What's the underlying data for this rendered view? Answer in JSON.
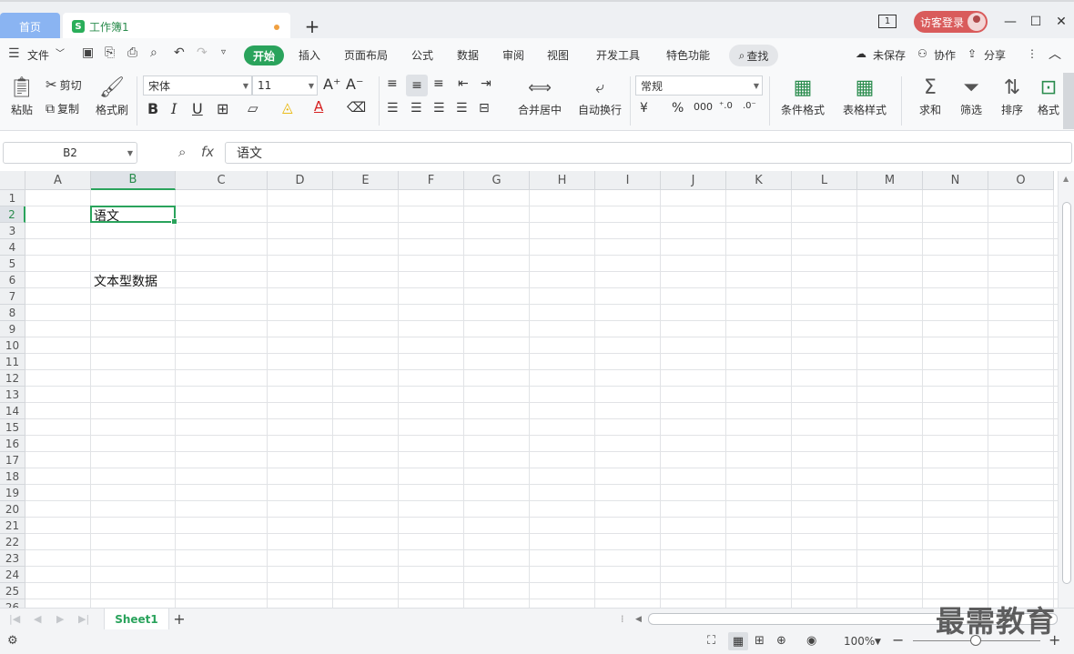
{
  "titlebar": {
    "home_tab": "首页",
    "doc_tab": "工作簿1",
    "doc_icon": "S",
    "add_tab": "+",
    "window_badge": "1",
    "login_label": "访客登录"
  },
  "menubar": {
    "file": "文件",
    "tabs": [
      "开始",
      "插入",
      "页面布局",
      "公式",
      "数据",
      "审阅",
      "视图",
      "开发工具",
      "特色功能"
    ],
    "search": "查找",
    "unsaved": "未保存",
    "collab": "协作",
    "share": "分享"
  },
  "ribbon": {
    "paste": "粘贴",
    "cut": "剪切",
    "copy": "复制",
    "format_painter": "格式刷",
    "font_name": "宋体",
    "font_size": "11",
    "merge_center": "合并居中",
    "wrap_text": "自动换行",
    "number_format": "常规",
    "conditional_format": "条件格式",
    "table_style": "表格样式",
    "sum": "求和",
    "filter": "筛选",
    "sort": "排序",
    "format": "格式"
  },
  "formula_bar": {
    "name_box": "B2",
    "fx_label": "fx",
    "content": "语文"
  },
  "grid": {
    "columns": [
      "A",
      "B",
      "C",
      "D",
      "E",
      "F",
      "G",
      "H",
      "I",
      "J",
      "K",
      "L",
      "M",
      "N",
      "O"
    ],
    "rows": [
      "1",
      "2",
      "3",
      "4",
      "5",
      "6",
      "7",
      "8",
      "9",
      "10",
      "11",
      "12",
      "13",
      "14",
      "15",
      "16",
      "17",
      "18",
      "19",
      "20",
      "21",
      "22",
      "23",
      "24",
      "25",
      "26"
    ],
    "selected_cell": "B2",
    "cells": {
      "B2": "语文",
      "B6": "文本型数据"
    }
  },
  "sheets": {
    "tabs": [
      "Sheet1"
    ],
    "add": "+"
  },
  "statusbar": {
    "zoom": "100%"
  },
  "watermark": "最需教育",
  "colors": {
    "accent": "#2aa35c",
    "home_tab": "#8ab4f2",
    "login": "#d95b5b"
  }
}
